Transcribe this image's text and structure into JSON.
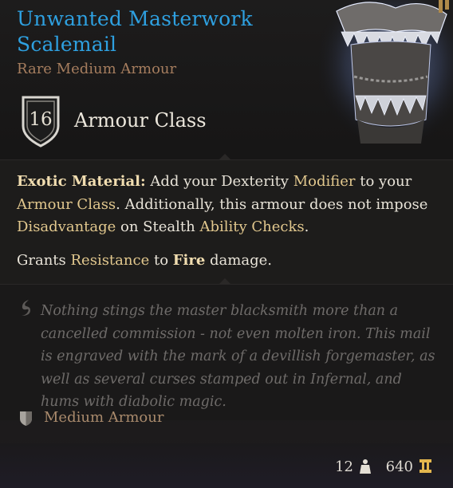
{
  "item": {
    "name": "Unwanted Masterwork Scalemail",
    "subtitle": "Rare Medium Armour",
    "rarity_color": "#2ea0e0",
    "art_icon": "scalemail-armour-art"
  },
  "armour_class": {
    "value": "16",
    "label": "Armour Class",
    "icon": "shield-icon"
  },
  "properties": {
    "p1": {
      "title": "Exotic Material:",
      "t1": " Add your Dexterity ",
      "k1": "Modifier",
      "t2": " to your ",
      "k2": "Armour Class",
      "t3": ". Additionally, this armour does not impose ",
      "k3": "Disadvantage",
      "t4": " on Stealth ",
      "k4": "Ability Checks",
      "t5": "."
    },
    "p2": {
      "t1": "Grants ",
      "k1": "Resistance",
      "t2": " to ",
      "k2": "Fire",
      "t3": " damage."
    },
    "keyword_color": "#e2c88e"
  },
  "lore": {
    "icon": "quill-icon",
    "text": "Nothing stings the master blacksmith more than a cancelled commission - not even molten iron. This mail is engraved with the mark of a devillish forgemaster, as well as several curses stamped out in Infernal, and hums with diabolic magic."
  },
  "category": {
    "icon": "medium-armour-icon",
    "label": "Medium Armour"
  },
  "footer": {
    "weight": "12",
    "weight_icon": "weight-icon",
    "value": "640",
    "value_icon": "gold-coin-icon"
  }
}
